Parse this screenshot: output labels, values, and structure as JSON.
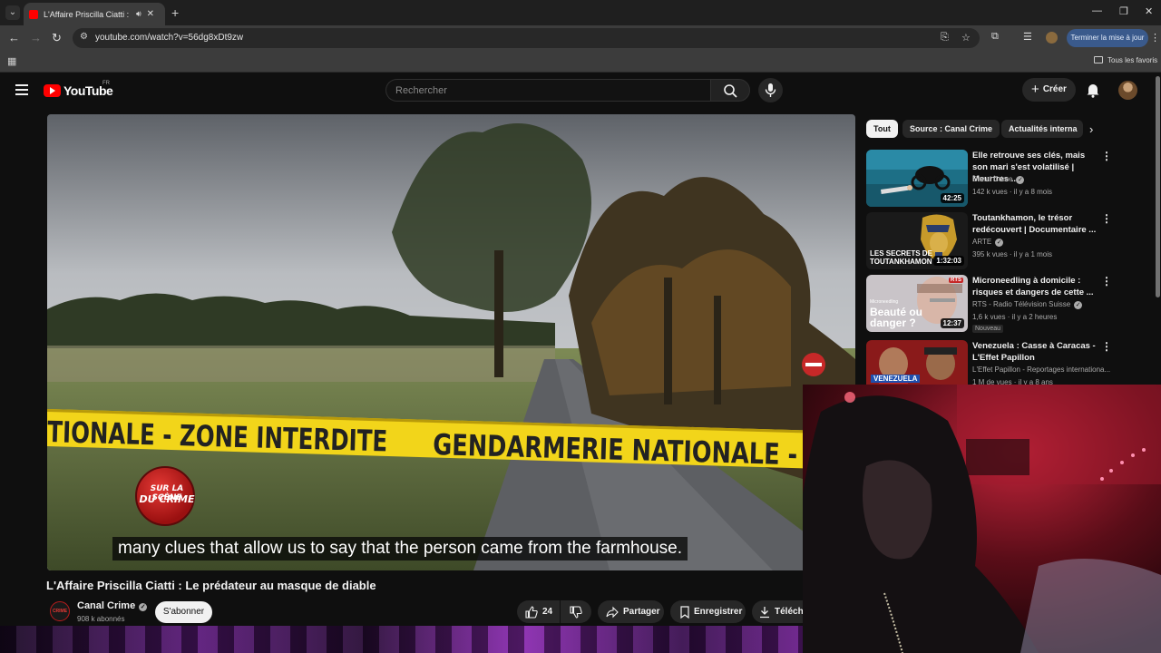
{
  "browser": {
    "tab_title": "L'Affaire Priscilla Ciatti : Le prédateur au masque de diable",
    "url": "youtube.com/watch?v=56dg8xDt9zw",
    "update_button": "Terminer la mise à jour",
    "bookmarks_all": "Tous les favoris"
  },
  "youtube": {
    "logo_text": "YouTube",
    "country_code": "FR",
    "search_placeholder": "Rechercher",
    "create_label": "Créer"
  },
  "video": {
    "caption": "many clues that allow us to say that the person came from the farmhouse.",
    "tape_left": "TIONALE - ZONE INTERDITE",
    "tape_right": "GENDARMERIE NATIONALE -",
    "badge_line1": "SUR LA SCÈNE",
    "badge_line2": "DU CRIME",
    "title": "L'Affaire Priscilla Ciatti : Le prédateur au masque de diable",
    "channel": "Canal Crime",
    "channel_avatar_text": "CRIME",
    "subscribers": "908 k abonnés",
    "subscribe_label": "S'abonner",
    "likes": "24",
    "share_label": "Partager",
    "save_label": "Enregistrer",
    "download_label": "Téléchar"
  },
  "chips": [
    "Tout",
    "Source : Canal Crime",
    "Actualités interna"
  ],
  "recommendations": [
    {
      "title": "Elle retrouve ses clés, mais son mari s'est volatilisé | Meurtres ...",
      "channel": "Canal Crime",
      "verified": true,
      "meta": "142 k vues · il y a 8 mois",
      "duration": "42:25",
      "badge": ""
    },
    {
      "title": "Toutankhamon, le trésor redécouvert | Documentaire ...",
      "channel": "ARTE",
      "verified": true,
      "meta": "395 k vues · il y a 1 mois",
      "duration": "1:32:03",
      "thumb_text": "LES SECRETS DE TOUTANKHAMON",
      "badge": ""
    },
    {
      "title": "Microneedling à domicile : risques et dangers de cette ...",
      "channel": "RTS - Radio Télévision Suisse",
      "verified": true,
      "meta": "1,6 k vues · il y a 2 heures",
      "duration": "12:37",
      "thumb_small": "Microneedling",
      "thumb_text": "Beauté ou danger ?",
      "thumb_logo": "RTS",
      "badge": "Nouveau"
    },
    {
      "title": "Venezuela : Casse à Caracas - L'Effet Papillon",
      "channel": "L'Effet Papillon - Reportages internationa...",
      "verified": false,
      "meta": "1 M de vues · il y a 8 ans",
      "thumb_text": "VENEZUELA",
      "badge": ""
    }
  ],
  "colors": {
    "yt_red": "#ff0000",
    "background": "#0f0f0f",
    "tape_yellow": "#f2d51a",
    "update_blue": "#3a5a8c"
  }
}
